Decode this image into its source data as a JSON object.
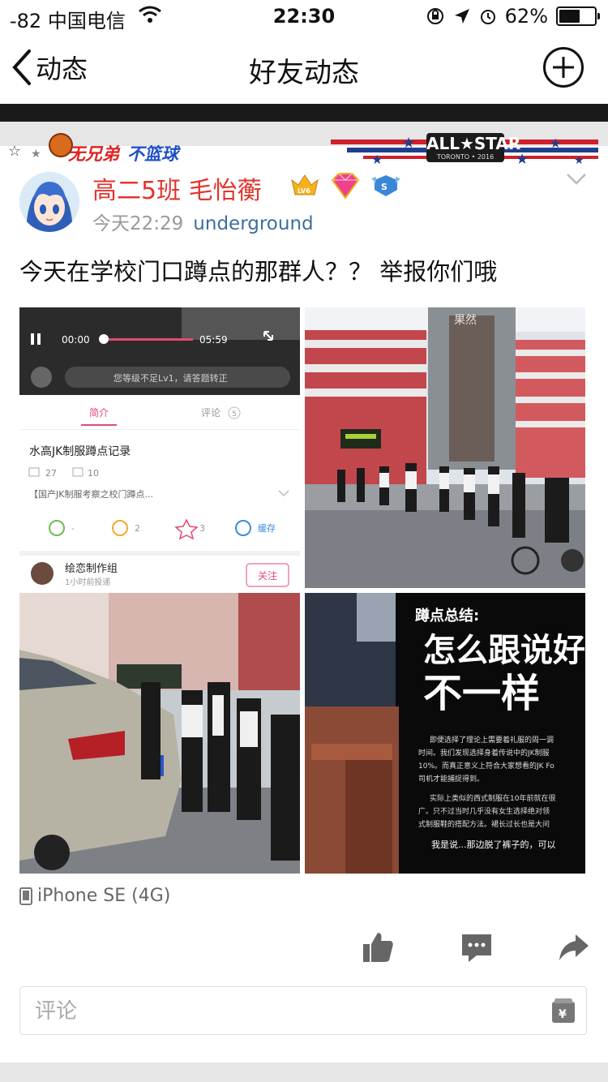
{
  "status_bar": {
    "carrier": "-82 中国电信",
    "time": "22:30",
    "battery": "62%",
    "battery_level": 0.62
  },
  "nav": {
    "back_label": "动态",
    "title": "好友动态"
  },
  "banner": {
    "slogan_left": "无兄弟",
    "slogan_right": "不篮球",
    "allstar_text": "ALL★STAR",
    "allstar_sub": "TORONTO • 2016"
  },
  "post": {
    "author": "高二5班  毛怡蘅",
    "time": "今天22:29",
    "location": "underground",
    "text": "今天在学校门口蹲点的那群人？？ 举报你们哦",
    "device": "iPhone SE (4G)"
  },
  "images": {
    "one": {
      "time_start": "00:00",
      "time_end": "05:59",
      "level_notice": "您等级不足Lv1，请答题转正",
      "tab_intro": "简介",
      "tab_comment": "评论",
      "comment_count": "5",
      "video_title": "水高JK制服蹲点记录",
      "views": "27",
      "danmaku": "10",
      "desc": "【国产JK制服考察之校门蹲点...",
      "coin": "2",
      "favorite": "3",
      "cache": "缓存",
      "uploader": "绘恋制作组",
      "upload_time": "1小时前投递",
      "follow": "关注"
    },
    "two": {
      "gate_text": "果然"
    },
    "four": {
      "heading": "蹲点总结:",
      "big1": "怎么跟说好",
      "big2": "不一样",
      "line1": "即便选择了理论上需要着礼服的周一调",
      "line2": "时间。我们发现选择身着传说中的JK制服",
      "line3": "10%。而真正意义上符合大家想看的JK Fo",
      "line4": "司机才能捕捉得到。",
      "line5": "实际上类似的西式制服在10年前就在很",
      "line6": "广。只不过当时几乎没有女生选择绝对领",
      "line7": "式制服鞋的搭配方法。裙长过长也是大问",
      "line8": "我是说...那边脱了裤子的，可以"
    }
  },
  "comment": {
    "placeholder": "评论"
  },
  "colors": {
    "name": "#e1352e",
    "location": "#3b6f9e",
    "progress": "#e24a72"
  }
}
